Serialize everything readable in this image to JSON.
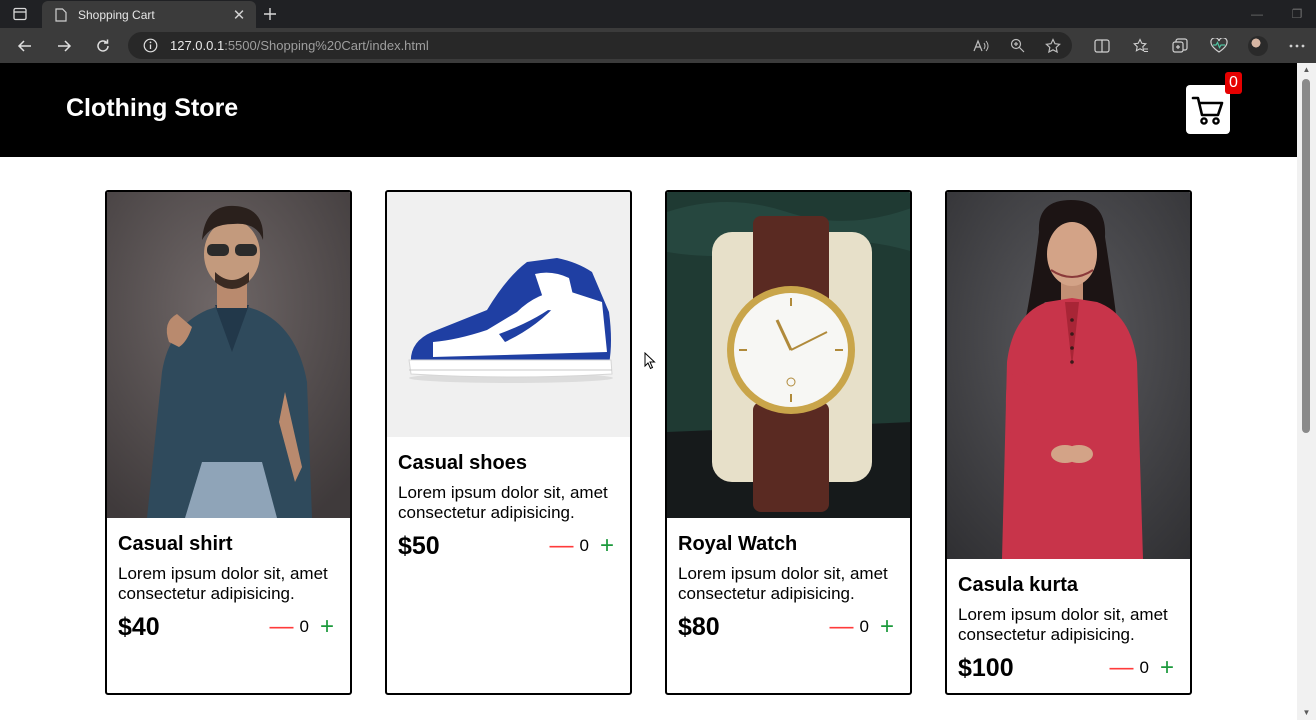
{
  "browser": {
    "tab_title": "Shopping Cart",
    "url_host": "127.0.0.1",
    "url_rest": ":5500/Shopping%20Cart/index.html",
    "icons": {
      "sidebar": "sidebar-toggle-icon",
      "page": "page-icon",
      "close": "close-icon",
      "new_tab": "plus-icon",
      "back": "back-arrow-icon",
      "forward": "forward-arrow-icon",
      "reload": "reload-icon",
      "info": "info-icon",
      "read_aloud": "read-aloud-icon",
      "zoom": "zoom-icon",
      "favorite": "star-icon",
      "split": "split-screen-icon",
      "favorites": "favorites-icon",
      "collections": "collections-icon",
      "health": "browser-essentials-icon",
      "profile": "avatar",
      "menu": "more-icon"
    }
  },
  "store": {
    "title": "Clothing Store",
    "cart_count": "0"
  },
  "products": [
    {
      "name": "Casual shirt",
      "description": "Lorem ipsum dolor sit, amet consectetur adipisicing.",
      "price": "$40",
      "qty": "0",
      "minus": "—",
      "plus": "+"
    },
    {
      "name": "Casual shoes",
      "description": "Lorem ipsum dolor sit, amet consectetur adipisicing.",
      "price": "$50",
      "qty": "0",
      "minus": "—",
      "plus": "+"
    },
    {
      "name": "Royal Watch",
      "description": "Lorem ipsum dolor sit, amet consectetur adipisicing.",
      "price": "$80",
      "qty": "0",
      "minus": "—",
      "plus": "+"
    },
    {
      "name": "Casula kurta",
      "description": "Lorem ipsum dolor sit, amet consectetur adipisicing.",
      "price": "$100",
      "qty": "0",
      "minus": "—",
      "plus": "+"
    }
  ],
  "colors": {
    "header_bg": "#000000",
    "badge_bg": "#e60000",
    "minus": "#ff3b3b",
    "plus": "#1c9a3c"
  }
}
